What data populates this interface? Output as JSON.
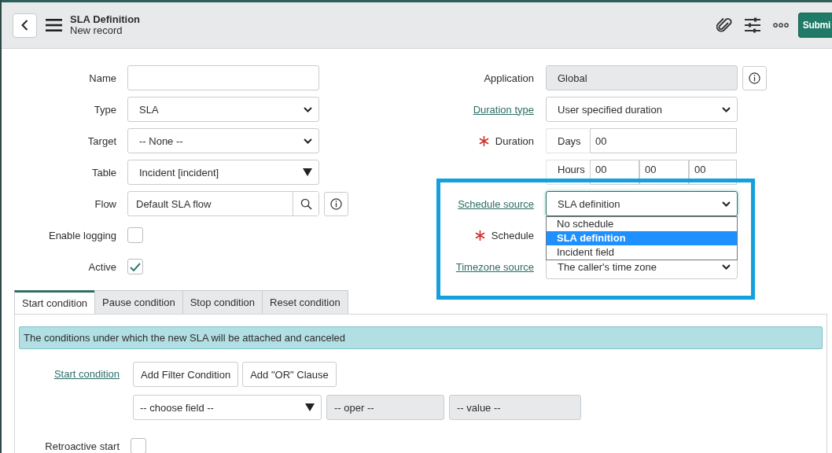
{
  "header": {
    "title": "SLA Definition",
    "subtitle": "New record",
    "submit": "Submi"
  },
  "left_fields": [
    {
      "kind": "text",
      "label": "Name"
    },
    {
      "kind": "select",
      "label": "Type",
      "value": "SLA"
    },
    {
      "kind": "select",
      "label": "Target",
      "value": "-- None --"
    },
    {
      "kind": "reference",
      "label": "Table",
      "value": "Incident [incident]"
    },
    {
      "kind": "lookup",
      "label": "Flow",
      "value": "Default SLA flow"
    },
    {
      "kind": "checkbox",
      "label": "Enable logging",
      "checked": false
    },
    {
      "kind": "checkbox",
      "label": "Active",
      "checked": true
    }
  ],
  "right_fields": [
    {
      "kind": "readonly",
      "label": "Application",
      "value": "Global"
    },
    {
      "kind": "select",
      "label": "Duration type",
      "link": true,
      "value": "User specified duration"
    },
    {
      "kind": "days",
      "label": "Duration",
      "required": true,
      "unit": "Days",
      "value": "00"
    },
    {
      "kind": "hours",
      "unit": "Hours",
      "hours": "00",
      "minutes": "00",
      "seconds": "00"
    },
    {
      "kind": "select",
      "label": "Schedule source",
      "link": true,
      "focused": true,
      "value": "SLA definition",
      "options": [
        {
          "label": "No schedule",
          "selected": false
        },
        {
          "label": "SLA definition",
          "selected": true
        },
        {
          "label": "Incident field",
          "selected": false
        }
      ]
    },
    {
      "kind": "blank",
      "label": "Schedule",
      "required": true
    },
    {
      "kind": "select",
      "label": "Timezone source",
      "link": true,
      "value": "The caller's time zone"
    }
  ],
  "tabs": [
    {
      "label": "Start condition",
      "selected": true
    },
    {
      "label": "Pause condition",
      "selected": false
    },
    {
      "label": "Stop condition",
      "selected": false
    },
    {
      "label": "Reset condition",
      "selected": false
    }
  ],
  "panel": {
    "banner": "The conditions under which the new SLA will be attached and canceled",
    "condition_label": "Start condition",
    "buttons": [
      "Add Filter Condition",
      "Add \"OR\" Clause"
    ],
    "filter": {
      "field": "-- choose field --",
      "oper": "-- oper --",
      "value": "-- value --"
    },
    "retroactive": {
      "label": "Retroactive start",
      "checked": false
    }
  }
}
